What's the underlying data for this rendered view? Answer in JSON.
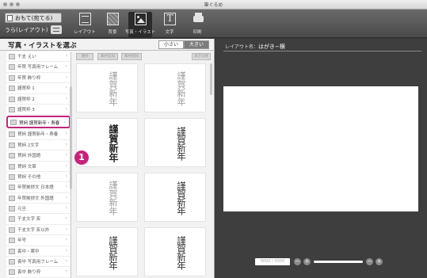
{
  "window": {
    "title": "筆ぐるめ"
  },
  "toolbar": {
    "doc_name": "おもて(宛てる)",
    "doc_sub": "うら(レイアウト)",
    "tools": [
      {
        "label": "レイアウト",
        "icon": "layout-icon"
      },
      {
        "label": "背景",
        "icon": "background-icon"
      },
      {
        "label": "写真・イラスト",
        "icon": "image-icon"
      },
      {
        "label": "文字",
        "icon": "text-icon"
      },
      {
        "label": "印刷",
        "icon": "printer-icon"
      }
    ],
    "active_tool": "写真・イラスト"
  },
  "left_panel": {
    "title": "写真・イラストを選ぶ",
    "size_small": "小さい",
    "size_large": "大きい",
    "categories": [
      "干支 えい",
      "年賀 写真用フレーム",
      "年賀 飾り枠",
      "謹賀枠 1",
      "謹賀枠 2",
      "謹賀枠 3",
      "賀詞 謹賀新年・寿春",
      "賀詞 謹賀新年・寿春",
      "賀詞 2文字",
      "賀詞 外国語",
      "賀詞 文章",
      "賀詞 その他",
      "年賀挨拶文 日本語",
      "年賀挨拶文 外国語",
      "元旦",
      "干支文字 亥",
      "干支文字 亥以外",
      "年号",
      "喪中・寒中",
      "喪中 写真用フレーム",
      "喪中 飾り枠"
    ],
    "selected_index": 6,
    "callout_number": "1",
    "image_toolbar": [
      "選択",
      "素材追加",
      "素材削除",
      "表示切替"
    ],
    "thumbnails": [
      {
        "text": "謹賀新年",
        "style": "light"
      },
      {
        "text": "謹賀新年",
        "style": "light"
      },
      {
        "text": "謹賀新年",
        "style": "bold"
      },
      {
        "text": "謹賀新年",
        "style": "brush"
      },
      {
        "text": "謹賀新年",
        "style": "light"
      },
      {
        "text": "謹賀新年",
        "style": "brush"
      },
      {
        "text": "謹賀新年",
        "style": "brush"
      },
      {
        "text": "謹賀新年",
        "style": "brush"
      }
    ]
  },
  "right_panel": {
    "layout_prefix": "レイアウト名：",
    "layout_name": "はがき−横",
    "zoom_field": "0000 / 0000"
  }
}
